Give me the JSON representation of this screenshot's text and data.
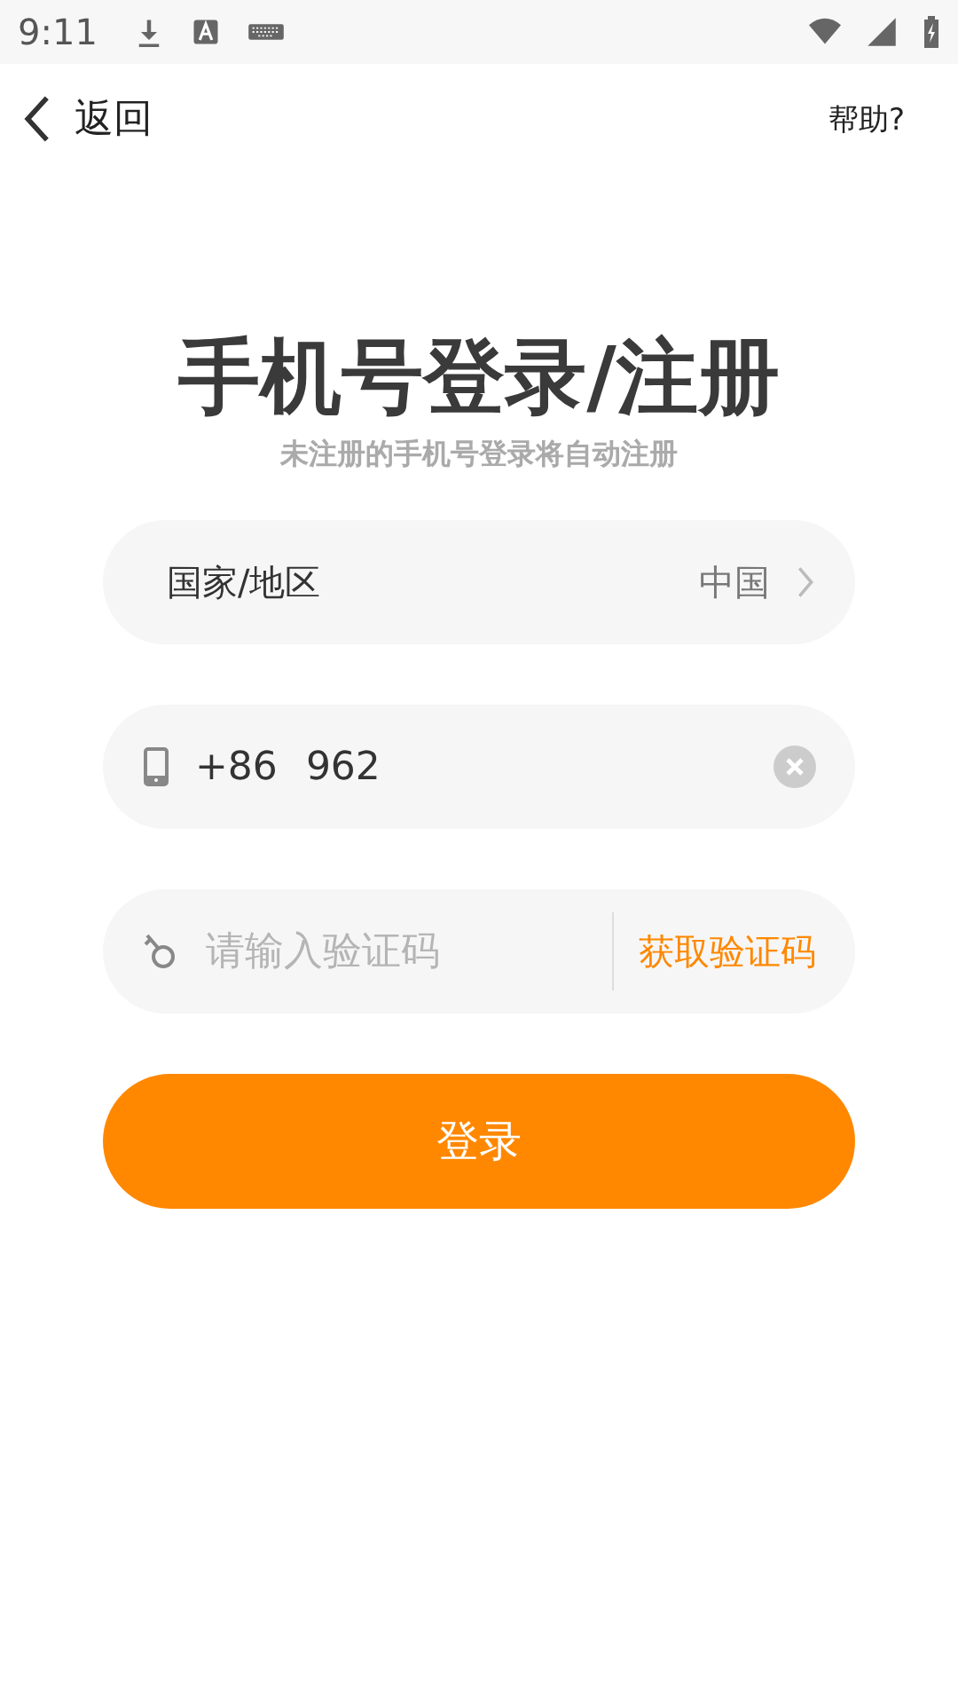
{
  "status_bar": {
    "time": "9:11"
  },
  "nav": {
    "back": "返回",
    "help": "帮助?"
  },
  "title": "手机号登录/注册",
  "subtitle": "未注册的手机号登录将自动注册",
  "region": {
    "label": "国家/地区",
    "value": "中国"
  },
  "phone": {
    "country_code": "+86",
    "value": "962"
  },
  "code": {
    "placeholder": "请输入验证码",
    "button": "获取验证码"
  },
  "login_button": "登录"
}
